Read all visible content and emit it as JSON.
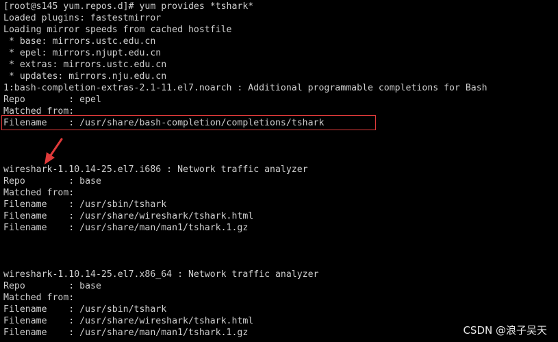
{
  "terminal": {
    "lines": [
      "[root@s145 yum.repos.d]# yum provides *tshark*",
      "Loaded plugins: fastestmirror",
      "Loading mirror speeds from cached hostfile",
      " * base: mirrors.ustc.edu.cn",
      " * epel: mirrors.njupt.edu.cn",
      " * extras: mirrors.ustc.edu.cn",
      " * updates: mirrors.nju.edu.cn",
      "1:bash-completion-extras-2.1-11.el7.noarch : Additional programmable completions for Bash",
      "Repo        : epel",
      "Matched from:",
      "Filename    : /usr/share/bash-completion/completions/tshark",
      "",
      "",
      "",
      "wireshark-1.10.14-25.el7.i686 : Network traffic analyzer",
      "Repo        : base",
      "Matched from:",
      "Filename    : /usr/sbin/tshark",
      "Filename    : /usr/share/wireshark/tshark.html",
      "Filename    : /usr/share/man/man1/tshark.1.gz",
      "",
      "",
      "",
      "wireshark-1.10.14-25.el7.x86_64 : Network traffic analyzer",
      "Repo        : base",
      "Matched from:",
      "Filename    : /usr/sbin/tshark",
      "Filename    : /usr/share/wireshark/tshark.html",
      "Filename    : /usr/share/man/man1/tshark.1.gz"
    ]
  },
  "annotations": {
    "highlight_color": "#e03a3a",
    "arrow_color": "#e03a3a"
  },
  "watermark": {
    "text": "CSDN @浪子吴天"
  }
}
